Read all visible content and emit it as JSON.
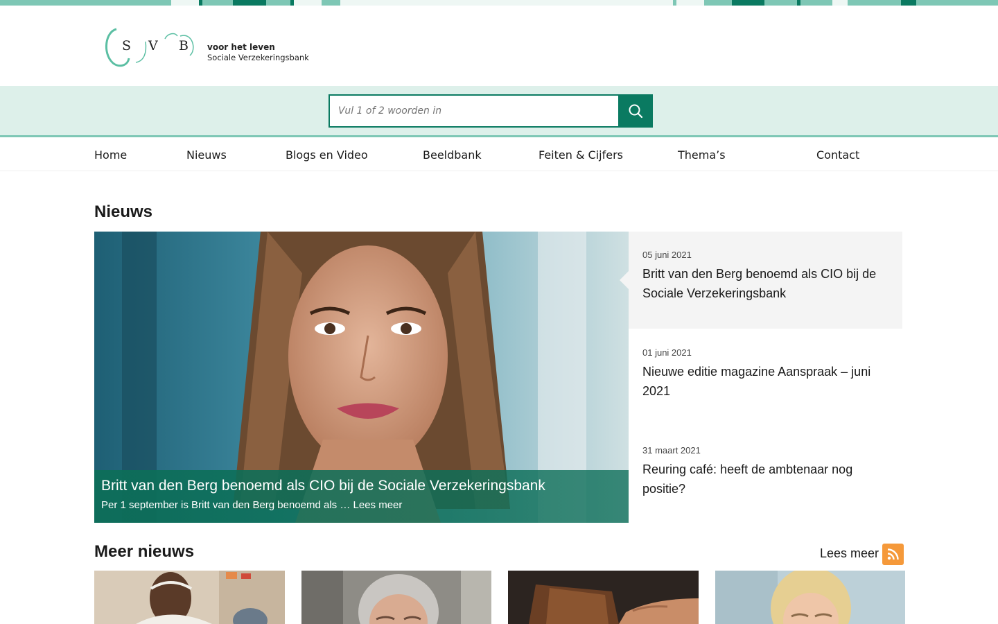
{
  "colors": {
    "brand_green": "#0a7a61",
    "light_green": "#7ec7b5",
    "mint": "#ddf0ea",
    "rss_orange": "#f5993a"
  },
  "logo": {
    "letters": [
      "S",
      "V",
      "B"
    ],
    "tagline1": "voor het leven",
    "tagline2": "Sociale Verzekeringsbank"
  },
  "search": {
    "placeholder": "Vul 1 of 2 woorden in",
    "button_icon": "search-icon"
  },
  "nav": {
    "items": [
      {
        "label": "Home"
      },
      {
        "label": "Nieuws"
      },
      {
        "label": "Blogs en Video"
      },
      {
        "label": "Beeldbank"
      },
      {
        "label": "Feiten & Cijfers"
      },
      {
        "label": "Thema’s"
      },
      {
        "label": "Contact"
      }
    ]
  },
  "news": {
    "heading": "Nieuws",
    "hero": {
      "title": "Britt van den Berg benoemd als CIO bij de Sociale Verzekeringsbank",
      "summary": "Per 1 september is Britt van den Berg benoemd als … Lees meer"
    },
    "items": [
      {
        "date": "05 juni 2021",
        "title": "Britt van den Berg benoemd als CIO bij de Sociale Verzekeringsbank"
      },
      {
        "date": "01 juni 2021",
        "title": "Nieuwe editie magazine Aanspraak – juni 2021"
      },
      {
        "date": "31 maart 2021",
        "title": "Reuring café: heeft de ambtenaar nog positie?"
      }
    ]
  },
  "meer_nieuws": {
    "heading": "Meer nieuws",
    "read_more": "Lees meer",
    "rss_icon": "rss-icon"
  }
}
